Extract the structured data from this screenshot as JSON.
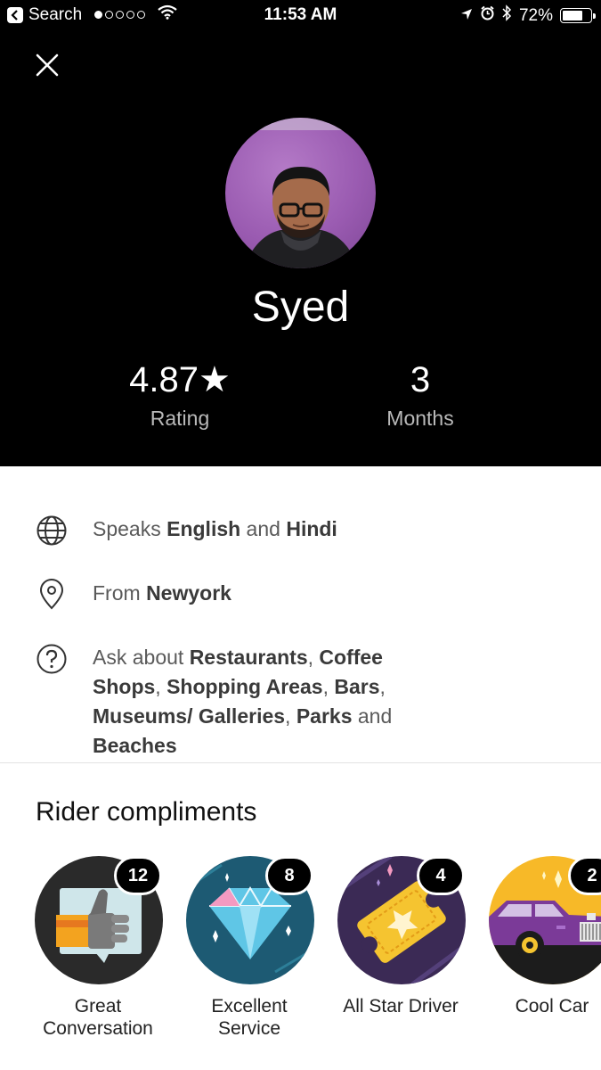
{
  "status_bar": {
    "back_label": "Search",
    "time": "11:53 AM",
    "battery": "72%",
    "signal_bars_filled": 1,
    "signal_bars_total": 5,
    "battery_level": 0.72
  },
  "profile": {
    "name": "Syed",
    "rating_value": "4.87",
    "rating_star": "★",
    "rating_label": "Rating",
    "months_value": "3",
    "months_label": "Months"
  },
  "info": {
    "languages": {
      "prefix": "Speaks ",
      "first": "English",
      "joiner": " and ",
      "second": "Hindi"
    },
    "location": {
      "prefix": "From ",
      "city": "Newyork"
    },
    "ask": {
      "prefix": "Ask about ",
      "t1": "Restaurants",
      "s1": ", ",
      "t2": "Coffee Shops",
      "s2": ", ",
      "t3": "Shopping Areas",
      "s3": ", ",
      "t4": "Bars",
      "s4": ", ",
      "t5": "Museums/ Galleries",
      "s5": ", ",
      "t6": "Parks",
      "s6": " and ",
      "t7": "Beaches"
    }
  },
  "compliments": {
    "title": "Rider compliments",
    "items": [
      {
        "label_line1": "Great",
        "label_line2": "Conversation",
        "count": "12",
        "icon": "thumbs-up-icon"
      },
      {
        "label_line1": "Excellent",
        "label_line2": "Service",
        "count": "8",
        "icon": "diamond-icon"
      },
      {
        "label_line1": "All Star Driver",
        "label_line2": "",
        "count": "4",
        "icon": "ticket-star-icon"
      },
      {
        "label_line1": "Cool Car",
        "label_line2": "",
        "count": "2",
        "icon": "car-icon"
      }
    ]
  },
  "colors": {
    "header_bg": "#000000",
    "diamond_bg": "#1d5a73",
    "ticket_bg": "#3b2a55",
    "car_bg": "#f7b928"
  }
}
